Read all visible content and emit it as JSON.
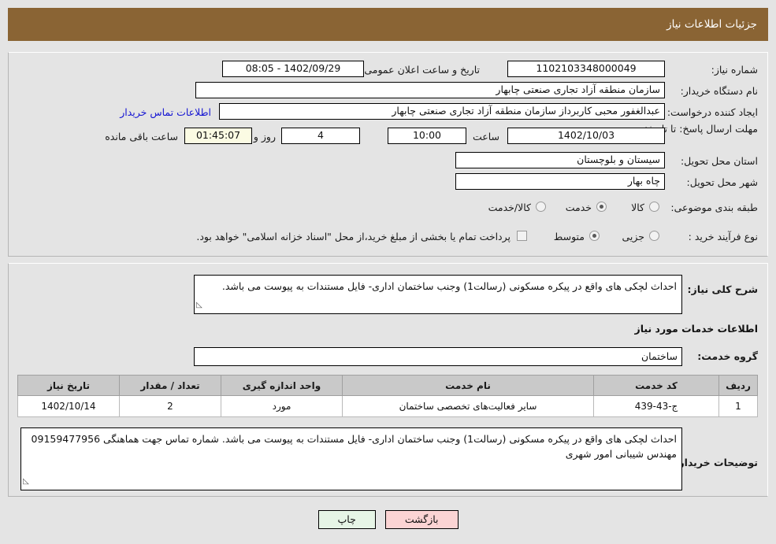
{
  "window": {
    "title": "جزئیات اطلاعات نیاز",
    "title_bar_color": "#8a6434"
  },
  "header_fields": {
    "need_number_label": "شماره نیاز:",
    "need_number_value": "1102103348000049",
    "announce_datetime_label": "تاریخ و ساعت اعلان عمومی:",
    "announce_datetime_value": "1402/09/29 - 08:05",
    "buyer_org_label": "نام دستگاه خریدار:",
    "buyer_org_value": "سازمان منطقه آزاد تجاری صنعتی چابهار",
    "requester_label": "ایجاد کننده درخواست:",
    "requester_value": "عبدالغفور محبی کاربرداز سازمان منطقه آزاد تجاری صنعتی چابهار",
    "buyer_contact_link": "اطلاعات تماس خریدار",
    "deadline_label": "مهلت ارسال پاسخ: تا تاریخ:",
    "deadline_date_value": "1402/10/03",
    "deadline_hour_label": "ساعت",
    "deadline_hour_value": "10:00",
    "days_value": "4",
    "days_label": "روز و",
    "countdown_value": "01:45:07",
    "countdown_label": "ساعت باقی مانده",
    "province_label": "استان محل تحویل:",
    "province_value": "سیستان و بلوچستان",
    "city_label": "شهر محل تحویل:",
    "city_value": "چاه بهار"
  },
  "classification": {
    "label": "طبقه بندی موضوعی:",
    "options": [
      {
        "label": "کالا",
        "selected": false
      },
      {
        "label": "خدمت",
        "selected": true
      },
      {
        "label": "کالا/خدمت",
        "selected": false
      }
    ]
  },
  "purchase_type": {
    "label": "نوع فرآیند خرید :",
    "options": [
      {
        "label": "جزیی",
        "selected": false
      },
      {
        "label": "متوسط",
        "selected": true
      }
    ],
    "checkbox_checked": false,
    "checkbox_text": "پرداخت تمام یا بخشی از مبلغ خرید،از محل \"اسناد خزانه اسلامی\" خواهد بود."
  },
  "general_description": {
    "label": "شرح کلی نیاز:",
    "value": "احداث لچکی های واقع در پیکره مسکونی (رسالت1) وجنب ساختمان اداری- فایل مستندات به پیوست می باشد."
  },
  "services_section": {
    "heading": "اطلاعات خدمات مورد نیاز",
    "service_group_label": "گروه خدمت:",
    "service_group_value": "ساختمان"
  },
  "table": {
    "columns": [
      "ردیف",
      "کد خدمت",
      "نام خدمت",
      "واحد اندازه گیری",
      "تعداد / مقدار",
      "تاریخ نیاز"
    ],
    "rows": [
      {
        "row_no": "1",
        "service_code": "ج-43-439",
        "service_name": "سایر فعالیت‌های تخصصی ساختمان",
        "unit": "مورد",
        "quantity": "2",
        "need_date": "1402/10/14"
      }
    ]
  },
  "buyer_notes": {
    "label": "توضیحات خریدار:",
    "value": "احداث لچکی های واقع در پیکره مسکونی (رسالت1) وجنب ساختمان اداری- فایل مستندات به پیوست می باشد. شماره تماس جهت هماهنگی 09159477956 مهندس شیبانی امور شهری"
  },
  "buttons": {
    "print": "چاپ",
    "back": "بازگشت"
  },
  "watermark": {
    "text": "AriaTender.net"
  }
}
